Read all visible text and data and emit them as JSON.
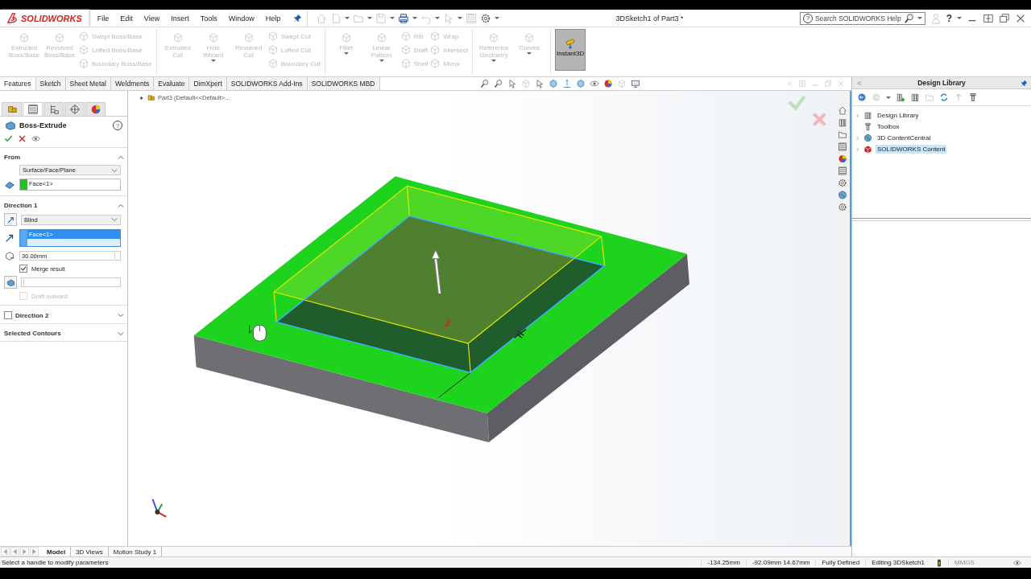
{
  "title_bar": {
    "logo": "SOLIDWORKS",
    "menu": [
      "File",
      "Edit",
      "View",
      "Insert",
      "Tools",
      "Window",
      "Help"
    ],
    "document_title": "3DSketch1 of Part3 *",
    "search": {
      "placeholder": "Search SOLIDWORKS Help"
    },
    "help": "?"
  },
  "ribbon": {
    "groups": [
      {
        "items": [
          {
            "kind": "large",
            "label": "Extruded Boss/Base",
            "disabled": true,
            "dropdown": false
          },
          {
            "kind": "large",
            "label": "Revolved Boss/Base",
            "disabled": true,
            "dropdown": false
          },
          {
            "kind": "stack",
            "items": [
              {
                "label": "Swept Boss/Base",
                "disabled": true
              },
              {
                "label": "Lofted Boss/Base",
                "disabled": true
              },
              {
                "label": "Boundary Boss/Base",
                "disabled": true
              }
            ]
          }
        ]
      },
      {
        "items": [
          {
            "kind": "large",
            "label": "Extruded Cut",
            "disabled": true,
            "dropdown": false
          },
          {
            "kind": "large",
            "label": "Hole Wizard",
            "disabled": true,
            "dropdown": true
          },
          {
            "kind": "large",
            "label": "Revolved Cut",
            "disabled": true,
            "dropdown": false
          },
          {
            "kind": "stack",
            "items": [
              {
                "label": "Swept Cut",
                "disabled": true
              },
              {
                "label": "Lofted Cut",
                "disabled": true
              },
              {
                "label": "Boundary Cut",
                "disabled": true
              }
            ]
          }
        ]
      },
      {
        "items": [
          {
            "kind": "large",
            "label": "Fillet",
            "disabled": true,
            "dropdown": true
          },
          {
            "kind": "large",
            "label": "Linear Pattern",
            "disabled": true,
            "dropdown": true
          },
          {
            "kind": "stack",
            "items": [
              {
                "label": "Rib",
                "disabled": true
              },
              {
                "label": "Draft",
                "disabled": true
              },
              {
                "label": "Shell",
                "disabled": true
              }
            ]
          },
          {
            "kind": "stack",
            "items": [
              {
                "label": "Wrap",
                "disabled": true
              },
              {
                "label": "Intersect",
                "disabled": true
              },
              {
                "label": "Mirror",
                "disabled": true
              }
            ]
          }
        ]
      },
      {
        "items": [
          {
            "kind": "large",
            "label": "Reference Geometry",
            "disabled": true,
            "dropdown": true
          },
          {
            "kind": "large",
            "label": "Curves",
            "disabled": true,
            "dropdown": true
          }
        ]
      },
      {
        "items": [
          {
            "kind": "toggle",
            "label": "Instant3D",
            "disabled": false,
            "selected": true
          }
        ]
      }
    ]
  },
  "tabs": [
    {
      "label": "Features",
      "selected": true
    },
    {
      "label": "Sketch",
      "selected": false
    },
    {
      "label": "Sheet Metal",
      "selected": false
    },
    {
      "label": "Weldments",
      "selected": false
    },
    {
      "label": "Evaluate",
      "selected": false
    },
    {
      "label": "DimXpert",
      "selected": false
    },
    {
      "label": "SOLIDWORKS Add-Ins",
      "selected": false
    },
    {
      "label": "SOLIDWORKS MBD",
      "selected": false
    }
  ],
  "panel_tabs": [
    {
      "selected": false
    },
    {
      "selected": true
    },
    {
      "selected": false
    },
    {
      "selected": false
    },
    {
      "selected": false
    }
  ],
  "property_manager": {
    "title": "Boss-Extrude",
    "help": "?",
    "sections": [
      {
        "kind": "from",
        "title": "From",
        "expanded": true,
        "condition": "Surface/Face/Plane",
        "selection": "Face<1>",
        "selection_active": false
      },
      {
        "kind": "direction",
        "title": "Direction 1",
        "expanded": true,
        "condition": "Blind",
        "selection": "Face<1>",
        "selection_active": true,
        "depth": "30.00mm",
        "merge_result": true,
        "merge_label": "Merge result",
        "draft_label": "Draft outward",
        "draft_outward": false,
        "draft_disabled": true
      },
      {
        "kind": "optional",
        "title": "Direction 2",
        "expanded": false,
        "checked": false
      },
      {
        "kind": "plain",
        "title": "Selected Contours",
        "expanded": false
      }
    ]
  },
  "feature_tree": {
    "label": "Part3  (Default<<Default>...",
    "expanded": false
  },
  "design_library": {
    "title": "Design Library",
    "items": [
      {
        "label": "Design Library",
        "expandable": true,
        "selected": false
      },
      {
        "label": "Toolbox",
        "expandable": false,
        "selected": false
      },
      {
        "label": "3D ContentCentral",
        "expandable": true,
        "selected": false
      },
      {
        "label": "SOLIDWORKS Content",
        "expandable": true,
        "selected": true
      }
    ]
  },
  "bottom_tabs": [
    {
      "label": "Model",
      "selected": true
    },
    {
      "label": "3D Views",
      "selected": false
    },
    {
      "label": "Motion Study 1",
      "selected": false
    }
  ],
  "status_bar": {
    "message": "Select a handle to modify parameters",
    "x": "-134.25mm",
    "yz": "-92.09mm 14.67mm",
    "state": "Fully Defined",
    "editing": "Editing 3DSketch1",
    "units": "MMGS",
    "units_disabled": true
  }
}
